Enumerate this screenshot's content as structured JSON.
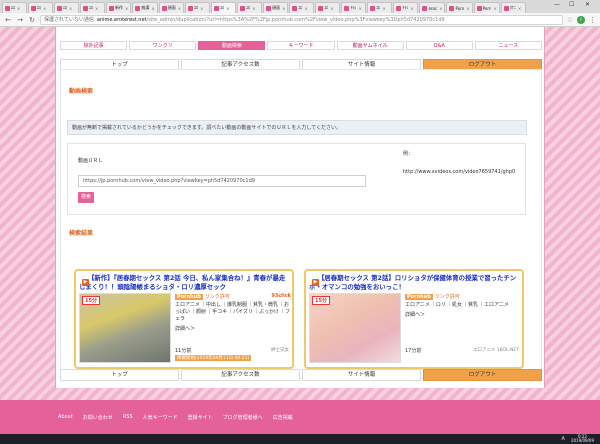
{
  "browser": {
    "tabs": [
      {
        "label": "ｴﾛ",
        "active": false
      },
      {
        "label": "ｴﾛ",
        "active": false
      },
      {
        "label": "ｴﾛ",
        "active": false
      },
      {
        "label": "ｴﾛ",
        "active": false
      },
      {
        "label": "新作",
        "active": false
      },
      {
        "label": "痴漢",
        "active": false
      },
      {
        "label": "顔面",
        "active": false
      },
      {
        "label": "ｴﾛ",
        "active": false
      },
      {
        "label": "ｴﾛ",
        "active": true
      },
      {
        "label": "ｴﾛ",
        "active": false
      },
      {
        "label": "顔面",
        "active": false
      },
      {
        "label": "ｴﾛ",
        "active": false
      },
      {
        "label": "ｴﾛ",
        "active": false
      },
      {
        "label": "ﾁﾗｼ",
        "active": false
      },
      {
        "label": "ｴﾛ",
        "active": false
      },
      {
        "label": "ﾁﾗｼ",
        "active": false
      },
      {
        "label": "eroc",
        "active": false
      },
      {
        "label": "Porn",
        "active": false
      },
      {
        "label": "Porn",
        "active": false
      },
      {
        "label": "ｵﾅﾆ",
        "active": false
      }
    ],
    "address": {
      "security": "保護されていない通信",
      "host": "anime.eroterest.net",
      "path": "/site_admin/duplication/?url=https%3A%2F%2Fjp.pornhub.com%2Fview_video.php%3Fviewkey%3Dph5d7420970c1d9"
    },
    "nav": {
      "back": "←",
      "forward": "→",
      "reload": "↻"
    },
    "star": "☆",
    "profile_initial": "i",
    "menu": "⋮"
  },
  "site": {
    "topnav": [
      {
        "label": "除外記事",
        "active": false
      },
      {
        "label": "ワンクリ",
        "active": false
      },
      {
        "label": "動画検索",
        "active": true
      },
      {
        "label": "キーワード",
        "active": false
      },
      {
        "label": "動画サムネイル",
        "active": false
      },
      {
        "label": "Q&A",
        "active": false
      },
      {
        "label": "ニュース",
        "active": false
      }
    ],
    "mainnav": [
      "トップ",
      "記事アクセス数",
      "サイト情報",
      "ログアウト"
    ],
    "video_search": {
      "title": "動画検索",
      "notice": "動画が無断で掲載されているかどうかをチェックできます。調べたい動画の動画サイトでのＵＲＬを入力してください。",
      "url_label": "動画ＵＲＬ",
      "url_value": "https://jp.pornhub.com/view_video.php?viewkey=ph5d7420970c1d9",
      "button": "検索",
      "example_label": "例：",
      "example_url": "http://www.xvideos.com/video7659741/ghp0"
    },
    "results": {
      "title": "検索結果",
      "cards": [
        {
          "title": "【新作】『居春期セックス 第2話 今日、私ん家集合ね！』青春が暴走しまくり！！頭陰陽帳まるショタ・ロリ濃厚セック",
          "duration": "15分",
          "site_badge": "Pornhub",
          "link_label": "リンク許可",
          "site_name": "93click",
          "tags": [
            "エロアニメ",
            "中出し",
            "爆乳制服",
            "貧乳・微乳",
            "おっぱい",
            "顔射",
            "手コキ",
            "パイズリ",
            "ぶっかけ",
            "フェラ"
          ],
          "more": "詳細ヘ＞",
          "length": "11分前",
          "date": "掲載開始(2019年09月11日 00:21)",
          "source": "紳士兄女"
        },
        {
          "title": "【居春期セックス 第2話】ロリショタが保健体育の授業で習ったチンポ・オマンコの勉強をおいっこ！",
          "duration": "15分",
          "site_badge": "Pornhub",
          "link_label": "リンク許可",
          "site_name": "",
          "tags": [
            "エロアニメ",
            "ロリ",
            "処女",
            "貧乳",
            "エロアニメ"
          ],
          "more": "詳細ヘ＞",
          "length": "17分前",
          "date": "",
          "source": "エロアニメ 18OL.NET"
        }
      ]
    },
    "footer": [
      "About",
      "お問い合わせ",
      "RSS",
      "人気キーワード",
      "登録サイト",
      "ブログ管理者様へ",
      "広告掲載"
    ]
  },
  "taskbar": {
    "time": "0:22",
    "date": "2019/09/09",
    "ime": "A"
  },
  "colors": {
    "accent": "#e5619a",
    "orange": "#f0a14a",
    "title_blue": "#1b2ec4",
    "section_orange": "#e2641f"
  }
}
